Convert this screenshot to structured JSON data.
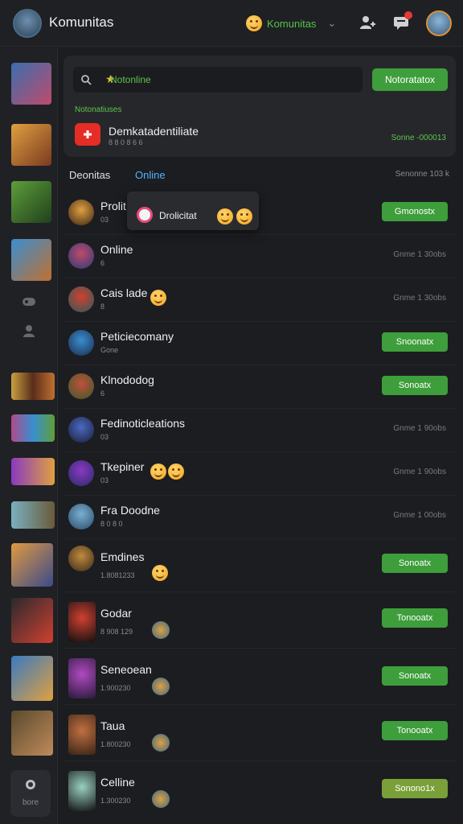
{
  "app": {
    "title": "Komunitas"
  },
  "header": {
    "community_label": "Komunitas",
    "icons": [
      "add-user-icon",
      "messages-icon",
      "profile-avatar"
    ],
    "colors": {
      "accent": "#54c14a",
      "notification": "#e53935"
    }
  },
  "sidebar": {
    "bottom_label": "bore"
  },
  "top_card": {
    "search_value": "Notonline",
    "primary_button": "Notoratatox",
    "section_label": "Notonatiuses",
    "featured": {
      "title": "Demkatadentiliate",
      "subtitle": "8 8 0 8 6 6",
      "meta": "Sonne -000013"
    }
  },
  "list_header": {
    "tab_primary": "Deonitas",
    "tab_online": "Online",
    "right_text": "Senonne 103 k"
  },
  "floating_card": {
    "label": "Drolicitat"
  },
  "rows": [
    {
      "name": "Prolit",
      "sub": "03",
      "button": "Gmonostx"
    },
    {
      "name": "Online",
      "sub": "6",
      "meta": "Gnme 1 30obs"
    },
    {
      "name": "Cais lade",
      "sub": "8",
      "meta": "Gnme 1 30obs"
    },
    {
      "name": "Peticiecomany",
      "sub": "Gone",
      "button": "Snoonatx"
    },
    {
      "name": "Klnododog",
      "sub": "6",
      "button": "Sonoatx"
    },
    {
      "name": "Fedinoticleations",
      "sub": "03",
      "meta": "Gnme 1 90obs"
    },
    {
      "name": "Tkepiner",
      "sub": "03",
      "meta": "Gnme 1 90obs"
    },
    {
      "name": "Fra Doodne",
      "sub": "8 0 8 0",
      "meta": "Gnme 1 00obs"
    },
    {
      "name": "Emdines",
      "sub": "1.8081233",
      "button": "Sonoatx"
    },
    {
      "name": "Godar",
      "sub": "8 908 129",
      "button": "Tonooatx"
    },
    {
      "name": "Seneoean",
      "sub": "1.900230",
      "button": "Sonoatx"
    },
    {
      "name": "Taua",
      "sub": "1.800230",
      "button": "Tonooatx"
    },
    {
      "name": "Celline",
      "sub": "1.300230",
      "button": "Sonono1x"
    }
  ]
}
